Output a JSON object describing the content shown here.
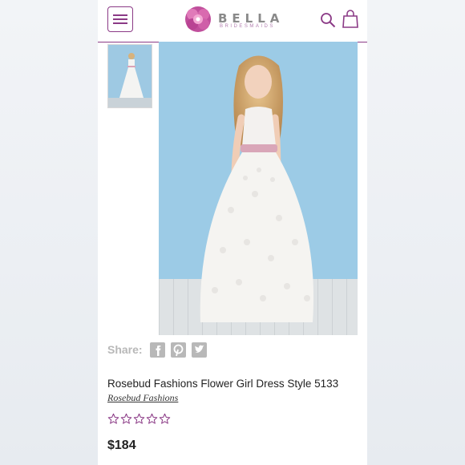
{
  "header": {
    "logo_title": "BELLA",
    "logo_subtitle": "BRIDESMAIDS"
  },
  "share": {
    "label": "Share:",
    "icons": [
      "facebook-icon",
      "pinterest-icon",
      "twitter-icon"
    ]
  },
  "product": {
    "title": "Rosebud Fashions Flower Girl Dress Style 5133",
    "brand": "Rosebud Fashions",
    "rating": 0,
    "rating_max": 5,
    "price": "$184"
  },
  "colors": {
    "brand": "#8b3a86",
    "backdrop": "#9ccbe6",
    "share_gray": "#b8b8b8"
  }
}
